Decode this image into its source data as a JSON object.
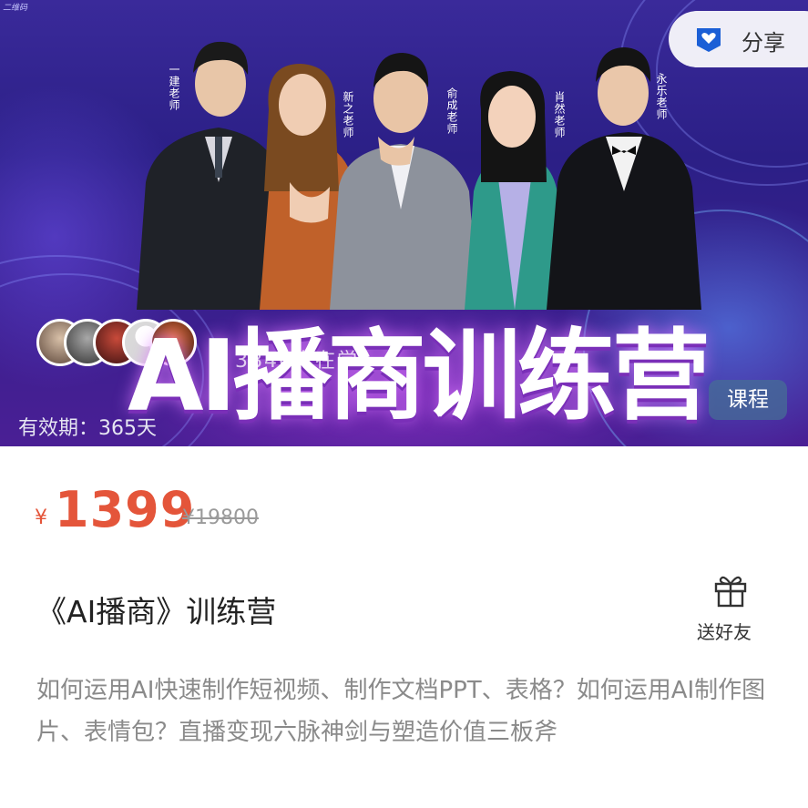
{
  "watermark": "二维码",
  "share": {
    "label": "分享",
    "icon": "share-heart-icon"
  },
  "banner": {
    "headline": "AI播商训练营",
    "overlay_text": "3840人在学",
    "teacher_labels": [
      "一建老师",
      "新之老师",
      "俞成老师",
      "肖然老师",
      "永乐老师"
    ],
    "validity": "有效期：365天",
    "tag": "课程",
    "colors": {
      "bg_top": "#3a2a9a",
      "bg_bottom": "#4a1f95",
      "accent_glow": "#c060e8"
    }
  },
  "price": {
    "currency": "¥",
    "current": "1399",
    "original": "¥19800",
    "color": "#e4553a"
  },
  "product": {
    "title": "《AI播商》训练营",
    "gift_label": "送好友",
    "gift_icon": "gift-icon",
    "description": "如何运用AI快速制作短视频、制作文档PPT、表格？如何运用AI制作图片、表情包？直播变现六脉神剑与塑造价值三板斧"
  }
}
